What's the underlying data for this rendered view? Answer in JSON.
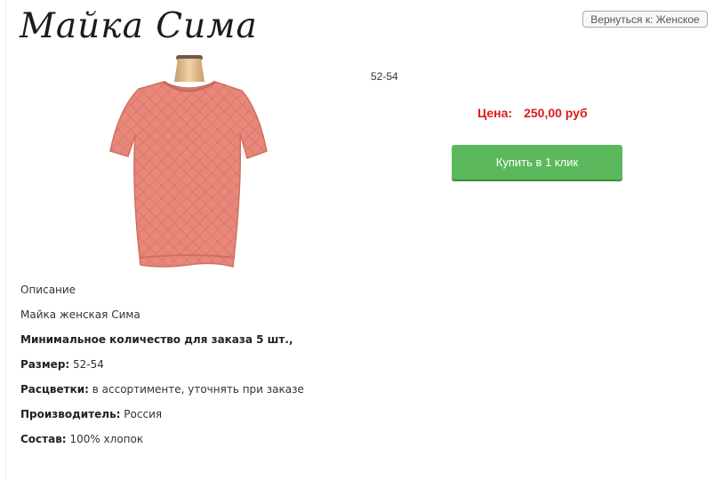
{
  "header": {
    "title": "Майка Сима",
    "back_button": "Вернуться к: Женское"
  },
  "product": {
    "image_icon": "knitted-shirt-photo",
    "size_option": "52-54",
    "price_label": "Цена:",
    "price_value": "250,00 руб",
    "buy_button": "Купить в 1 клик"
  },
  "description": {
    "heading": "Описание",
    "name": "Майка женская Сима",
    "min_order": "Минимальное количество для заказа 5 шт.,",
    "size_label": "Размер:",
    "size_value": "52-54",
    "colors_label": "Расцветки:",
    "colors_value": "в ассортименте, уточнять при заказе",
    "maker_label": "Производитель:",
    "maker_value": "Россия",
    "composition_label": "Состав:",
    "composition_value": "100% хлопок"
  },
  "colors": {
    "accent_button": "#5cb85c",
    "price_red": "#d91c1c",
    "shirt": "#e8877a"
  }
}
